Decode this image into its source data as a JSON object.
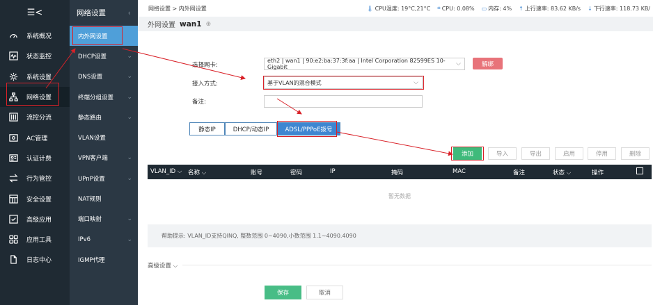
{
  "nav1": {
    "toggle_glyph": "☰<",
    "items": [
      {
        "icon": "dashboard-icon",
        "label": "系统概况"
      },
      {
        "icon": "monitor-icon",
        "label": "状态监控"
      },
      {
        "icon": "gear-icon",
        "label": "系统设置"
      },
      {
        "icon": "network-icon",
        "label": "网络设置"
      },
      {
        "icon": "traffic-icon",
        "label": "流控分流"
      },
      {
        "icon": "ac-icon",
        "label": "AC管理"
      },
      {
        "icon": "auth-icon",
        "label": "认证计费"
      },
      {
        "icon": "behavior-icon",
        "label": "行为管控"
      },
      {
        "icon": "security-icon",
        "label": "安全设置"
      },
      {
        "icon": "advanced-icon",
        "label": "高级应用"
      },
      {
        "icon": "tools-icon",
        "label": "应用工具"
      },
      {
        "icon": "log-icon",
        "label": "日志中心"
      }
    ]
  },
  "nav2": {
    "title": "网络设置",
    "collapse_glyph": "‹",
    "items": [
      {
        "label": "内外网设置",
        "chev": ""
      },
      {
        "label": "DHCP设置",
        "chev": "⌄"
      },
      {
        "label": "DNS设置",
        "chev": "⌄"
      },
      {
        "label": "终端分组设置",
        "chev": "⌄"
      },
      {
        "label": "静态路由",
        "chev": "⌄"
      },
      {
        "label": "VLAN设置",
        "chev": ""
      },
      {
        "label": "VPN客户端",
        "chev": "⌄"
      },
      {
        "label": "UPnP设置",
        "chev": "⌄"
      },
      {
        "label": "NAT规则",
        "chev": ""
      },
      {
        "label": "端口映射",
        "chev": "⌄"
      },
      {
        "label": "IPv6",
        "chev": "⌄"
      },
      {
        "label": "IGMP代理",
        "chev": ""
      }
    ]
  },
  "topbar": {
    "breadcrumb": "网络设置 > 内外网设置",
    "cpu_temp": "CPU温度: 19°C,21°C",
    "cpu": "CPU: 0.08%",
    "mem": "内存: 4%",
    "up": "上行速率: 83.62 KB/s",
    "down": "下行速率: 118.73 KB/"
  },
  "title": {
    "prefix": "外网设置",
    "name": "wan1",
    "plus": "⊕"
  },
  "form": {
    "nic_label": "选择网卡:",
    "nic_value": "eth2 | wan1 | 90:e2:ba:37:3f:aa | Intel Corporation 82599ES 10-Gigabit",
    "unbind": "解绑",
    "mode_label": "接入方式:",
    "mode_value": "基于VLAN的混合模式",
    "note_label": "备注:"
  },
  "tabs": [
    "静态IP",
    "DHCP/动态IP",
    "ADSL/PPPoE拨号"
  ],
  "toolbar": {
    "add": "添加",
    "import": "导入",
    "export": "导出",
    "enable": "启用",
    "disable": "停用",
    "delete": "删除"
  },
  "table": {
    "headers": [
      "VLAN_ID ⌵",
      "名称 ⌵",
      "账号",
      "密码",
      "IP",
      "掩码",
      "MAC",
      "备注",
      "状态 ⌵",
      "操作"
    ],
    "empty": "暂无数据"
  },
  "hint": "帮助提示: VLAN_ID支持QINQ, 整数范围 0~4090,小数范围 1.1~4090.4090",
  "advanced": "高级设置 ⌵",
  "actions": {
    "save": "保存",
    "cancel": "取消"
  },
  "annotation_color": "#d92128"
}
